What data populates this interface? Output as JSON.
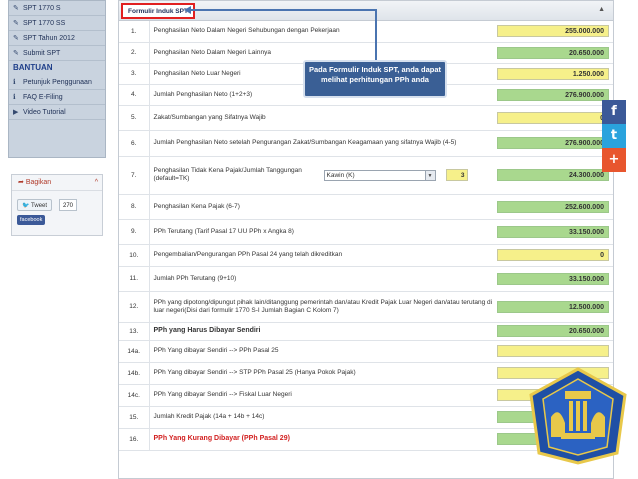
{
  "sidebar": {
    "items": [
      {
        "label": "SPT 1770 S",
        "icon": "edit-icon"
      },
      {
        "label": "SPT 1770 SS",
        "icon": "edit-icon"
      },
      {
        "label": "SPT Tahun 2012",
        "icon": "edit-icon"
      },
      {
        "label": "Submit SPT",
        "icon": "edit-icon"
      }
    ],
    "help_heading": "BANTUAN",
    "help_items": [
      {
        "label": "Petunjuk Penggunaan",
        "icon": "info-icon"
      },
      {
        "label": "FAQ E-Filing",
        "icon": "info-icon"
      },
      {
        "label": "Video Tutorial",
        "icon": "play-icon"
      }
    ]
  },
  "share": {
    "title": "Bagikan",
    "tweet_label": "Tweet",
    "tweet_count": "270",
    "facebook_label": "facebook"
  },
  "form": {
    "tab_label": "Formulir Induk SPT",
    "rows": [
      {
        "no": "1.",
        "desc": "Penghasilan Neto Dalam Negeri Sehubungan dengan Pekerjaan",
        "value": "255.000.000",
        "color": "yellow"
      },
      {
        "no": "2.",
        "desc": "Penghasilan Neto Dalam Negeri Lainnya",
        "value": "20.650.000",
        "color": "green"
      },
      {
        "no": "3.",
        "desc": "Penghasilan Neto Luar Negeri",
        "value": "1.250.000",
        "color": "yellow"
      },
      {
        "no": "4.",
        "desc": "Jumlah Penghasilan Neto (1+2+3)",
        "value": "276.900.000",
        "color": "green"
      },
      {
        "no": "5.",
        "desc": "Zakat/Sumbangan yang Sifatnya Wajib",
        "value": "0",
        "color": "yellow"
      },
      {
        "no": "6.",
        "desc": "Jumlah Penghasilan Neto setelah Pengurangan Zakat/Sumbangan Keagamaan yang sifatnya Wajib (4-5)",
        "value": "276.900.000",
        "color": "green"
      },
      {
        "no": "7.",
        "desc": "Penghasilan Tidak Kena Pajak/Jumlah Tanggungan (default=TK)",
        "select": "Kawin (K)",
        "dependents": "3",
        "value": "24.300.000",
        "color": "green"
      },
      {
        "no": "8.",
        "desc": "Penghasilan Kena Pajak (6-7)",
        "value": "252.600.000",
        "color": "green"
      },
      {
        "no": "9.",
        "desc": "PPh Terutang (Tarif Pasal 17 UU PPh x Angka 8)",
        "value": "33.150.000",
        "color": "green"
      },
      {
        "no": "10.",
        "desc": "Pengembalian/Pengurangan PPh Pasal 24 yang telah dikreditkan",
        "value": "0",
        "color": "yellow"
      },
      {
        "no": "11.",
        "desc": "Jumlah PPh Terutang (9+10)",
        "value": "33.150.000",
        "color": "green"
      },
      {
        "no": "12.",
        "desc": "PPh yang dipotong/dipungut pihak lain/ditanggung pemerintah dan/atau Kredit Pajak Luar Negeri dan/atau terutang di luar negeri(Disi dari formulir 1770 S-I Jumlah Bagian C Kolom 7)",
        "value": "12.500.000",
        "color": "green"
      },
      {
        "no": "13.",
        "desc": "PPh yang Harus Dibayar Sendiri",
        "value": "20.650.000",
        "color": "green",
        "style": "bold"
      },
      {
        "no": "14a.",
        "desc": "PPh Yang dibayar Sendiri --> PPh Pasal 25",
        "value": "",
        "color": "yellow"
      },
      {
        "no": "14b.",
        "desc": "PPh Yang dibayar Sendiri --> STP PPh Pasal 25 (Hanya Pokok Pajak)",
        "value": "",
        "color": "yellow"
      },
      {
        "no": "14c.",
        "desc": "PPh Yang dibayar Sendiri --> Fiskal Luar Negeri",
        "value": "",
        "color": "yellow"
      },
      {
        "no": "15.",
        "desc": "Jumlah Kredit Pajak (14a + 14b + 14c)",
        "value": "",
        "color": "green"
      },
      {
        "no": "16.",
        "desc": "PPh Yang Kurang Dibayar (PPh Pasal 29)",
        "value": "20.650.000",
        "color": "green",
        "style": "red"
      }
    ]
  },
  "callout": {
    "text": "Pada Formulir Induk SPT, anda dapat melihat perhitungan PPh anda"
  },
  "social": [
    {
      "icon": "facebook-icon",
      "glyph": "f",
      "color": "#3b5998"
    },
    {
      "icon": "twitter-icon",
      "glyph": "t",
      "color": "#2aa3dd"
    },
    {
      "icon": "plus-icon",
      "glyph": "+",
      "color": "#e8562e"
    }
  ]
}
